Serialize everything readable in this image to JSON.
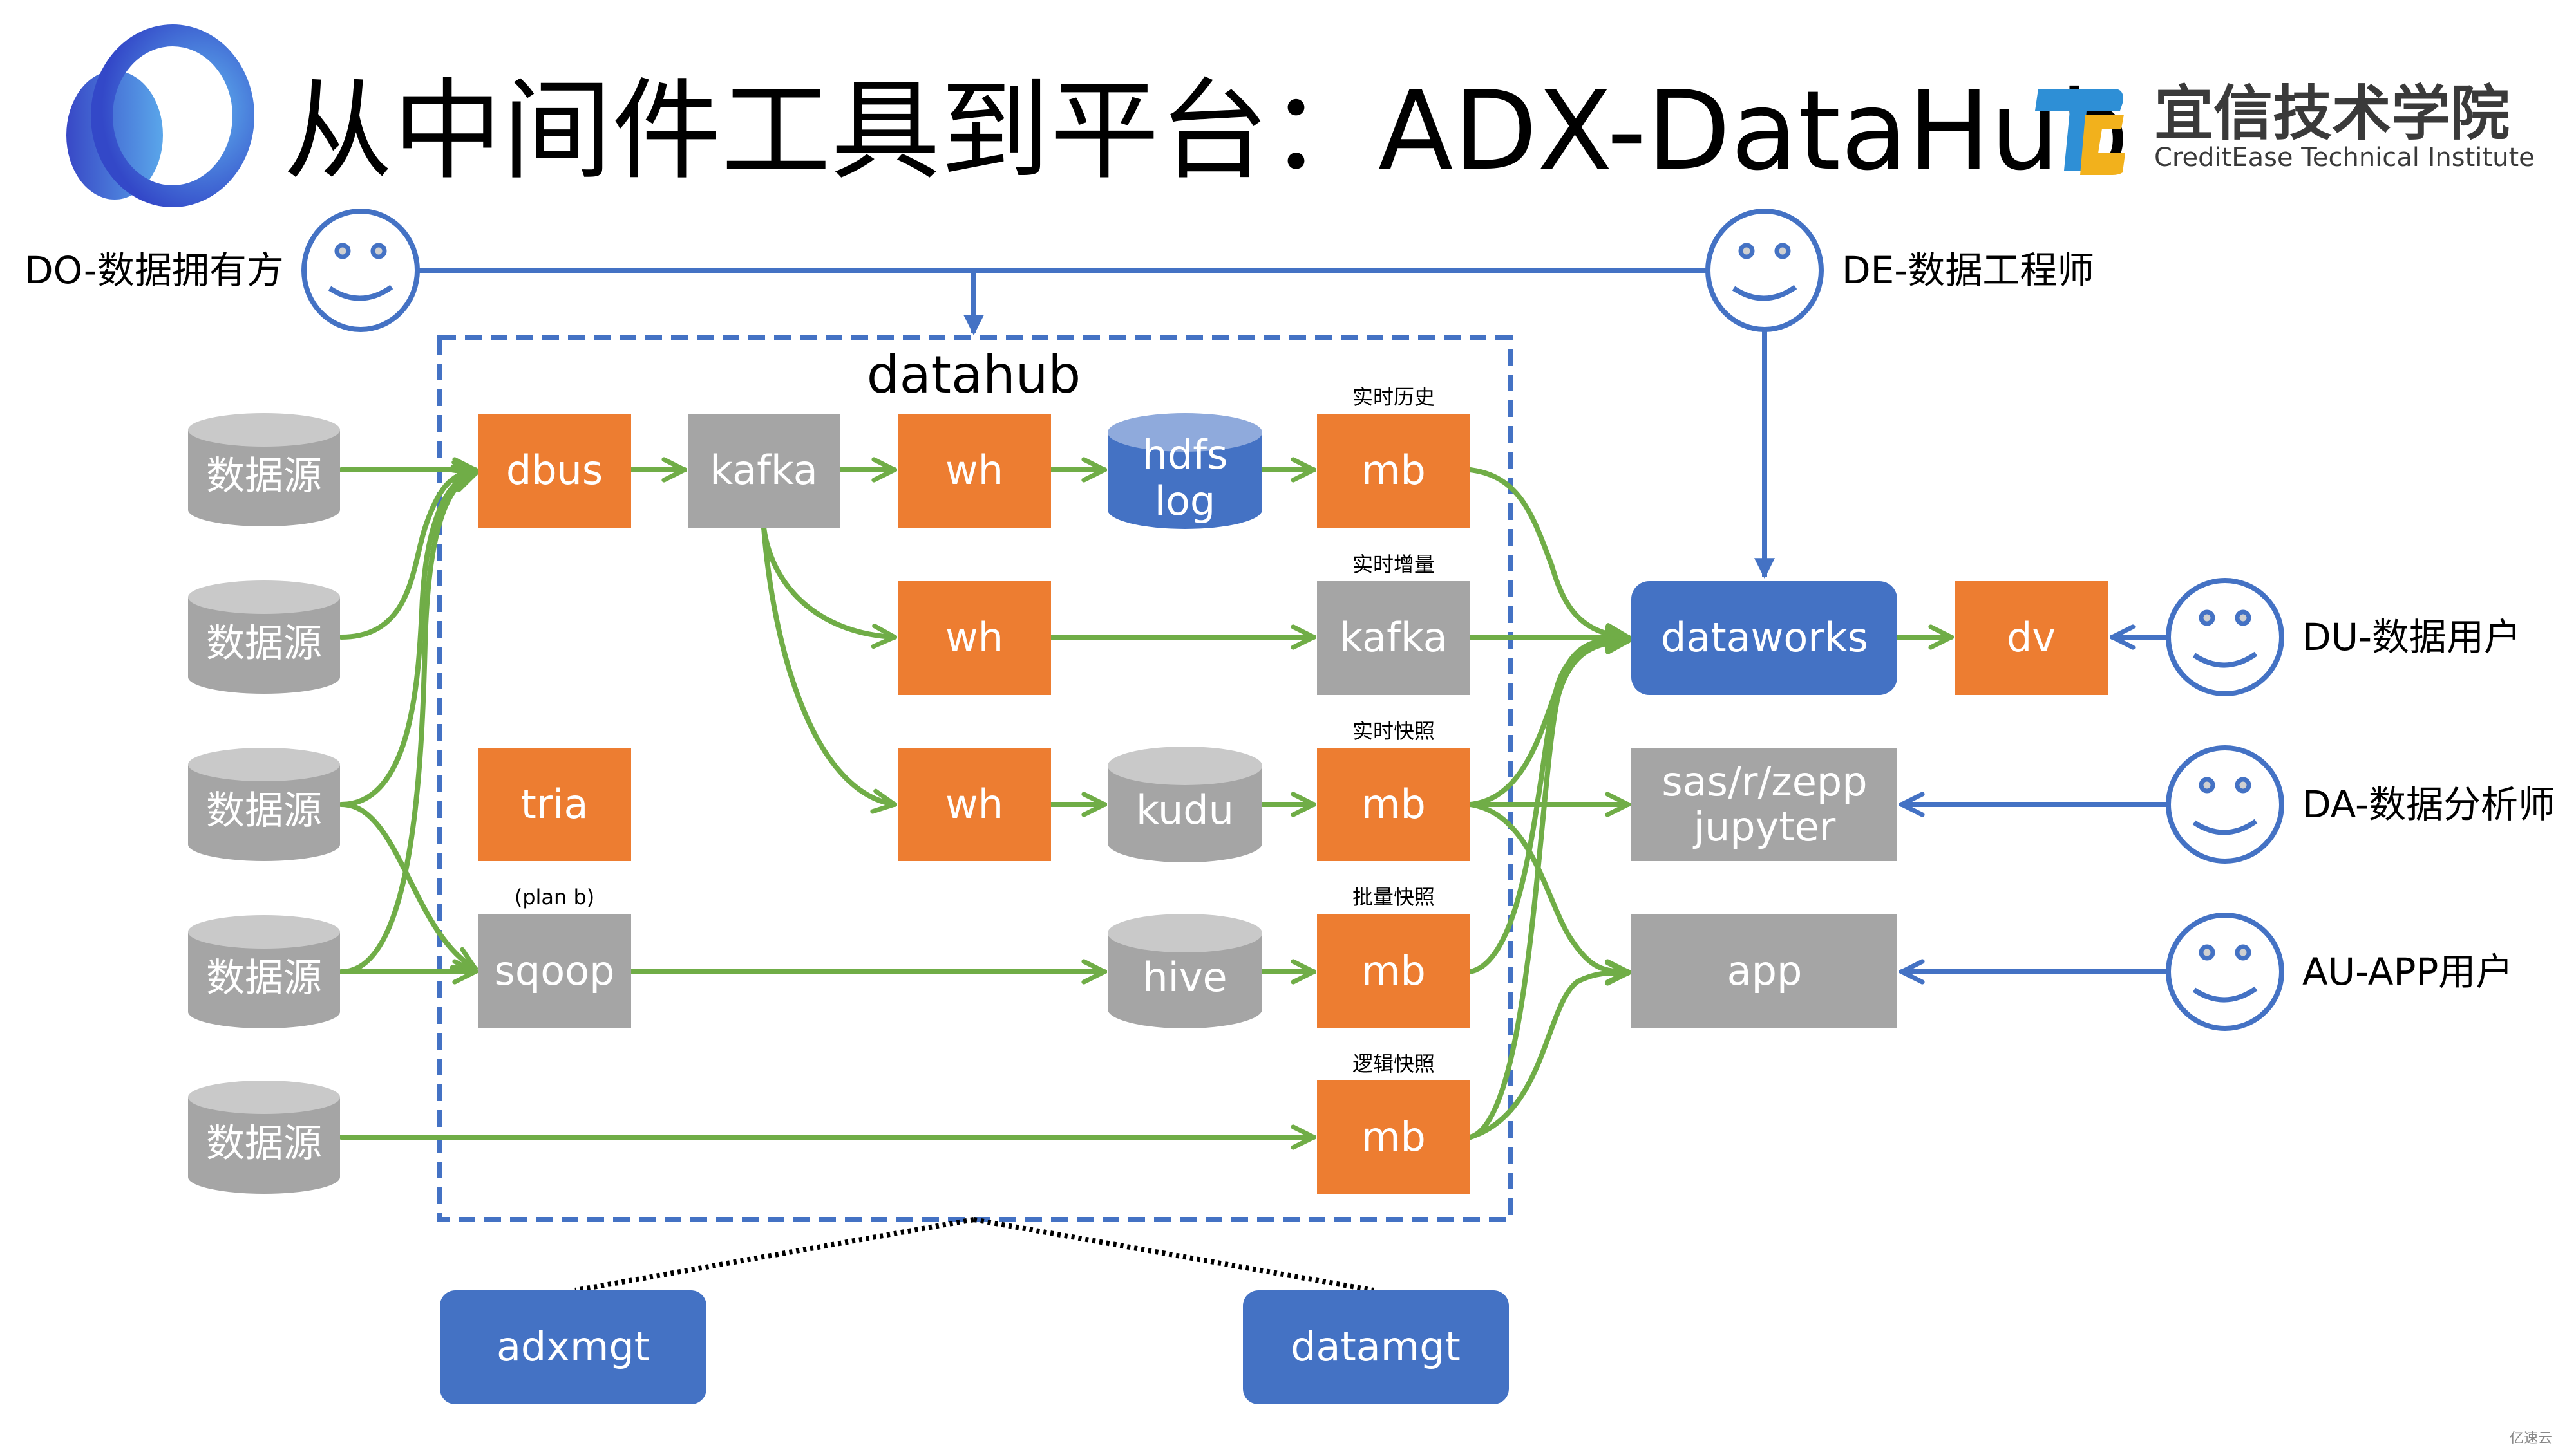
{
  "title": "从中间件工具到平台：ADX-DataHub",
  "brand": {
    "name_cn": "宜信技术学院",
    "name_en": "CreditEase Technical Institute",
    "colors": {
      "blue": "#2e8fd6",
      "yellow": "#f2b11c"
    }
  },
  "colors": {
    "orange": "#ed7d31",
    "gray": "#a5a5a5",
    "blue": "#4472c4",
    "green": "#70ad47",
    "cylinder_gray": "#a5a5a5",
    "cylinder_top": "#c9c9c9",
    "hdfs_top": "#8faadc"
  },
  "roles": {
    "do": "DO-数据拥有方",
    "de": "DE-数据工程师",
    "du": "DU-数据用户",
    "da": "DA-数据分析师",
    "au": "AU-APP用户"
  },
  "datahub": {
    "label": "datahub",
    "sources": [
      "数据源",
      "数据源",
      "数据源",
      "数据源",
      "数据源"
    ],
    "nodes": {
      "dbus": "dbus",
      "kafka": "kafka",
      "wh1": "wh",
      "wh2": "wh",
      "wh3": "wh",
      "hdfs_line1": "hdfs",
      "hdfs_line2": "log",
      "kudu": "kudu",
      "hive": "hive",
      "tria": "tria",
      "sqoop": "sqoop",
      "sqoop_note": "(plan b)",
      "kafka2": "kafka",
      "mb1": "mb",
      "mb3": "mb",
      "mb4": "mb",
      "mb5": "mb"
    },
    "captions": {
      "realtime_history": "实时历史",
      "realtime_increment": "实时增量",
      "realtime_snapshot": "实时快照",
      "batch_snapshot": "批量快照",
      "logical_snapshot": "逻辑快照"
    }
  },
  "consumers": {
    "dataworks": "dataworks",
    "dv": "dv",
    "sas_line1": "sas/r/zepp",
    "sas_line2": "jupyter",
    "app": "app"
  },
  "management": {
    "adxmgt": "adxmgt",
    "datamgt": "datamgt"
  },
  "watermark": "亿速云"
}
